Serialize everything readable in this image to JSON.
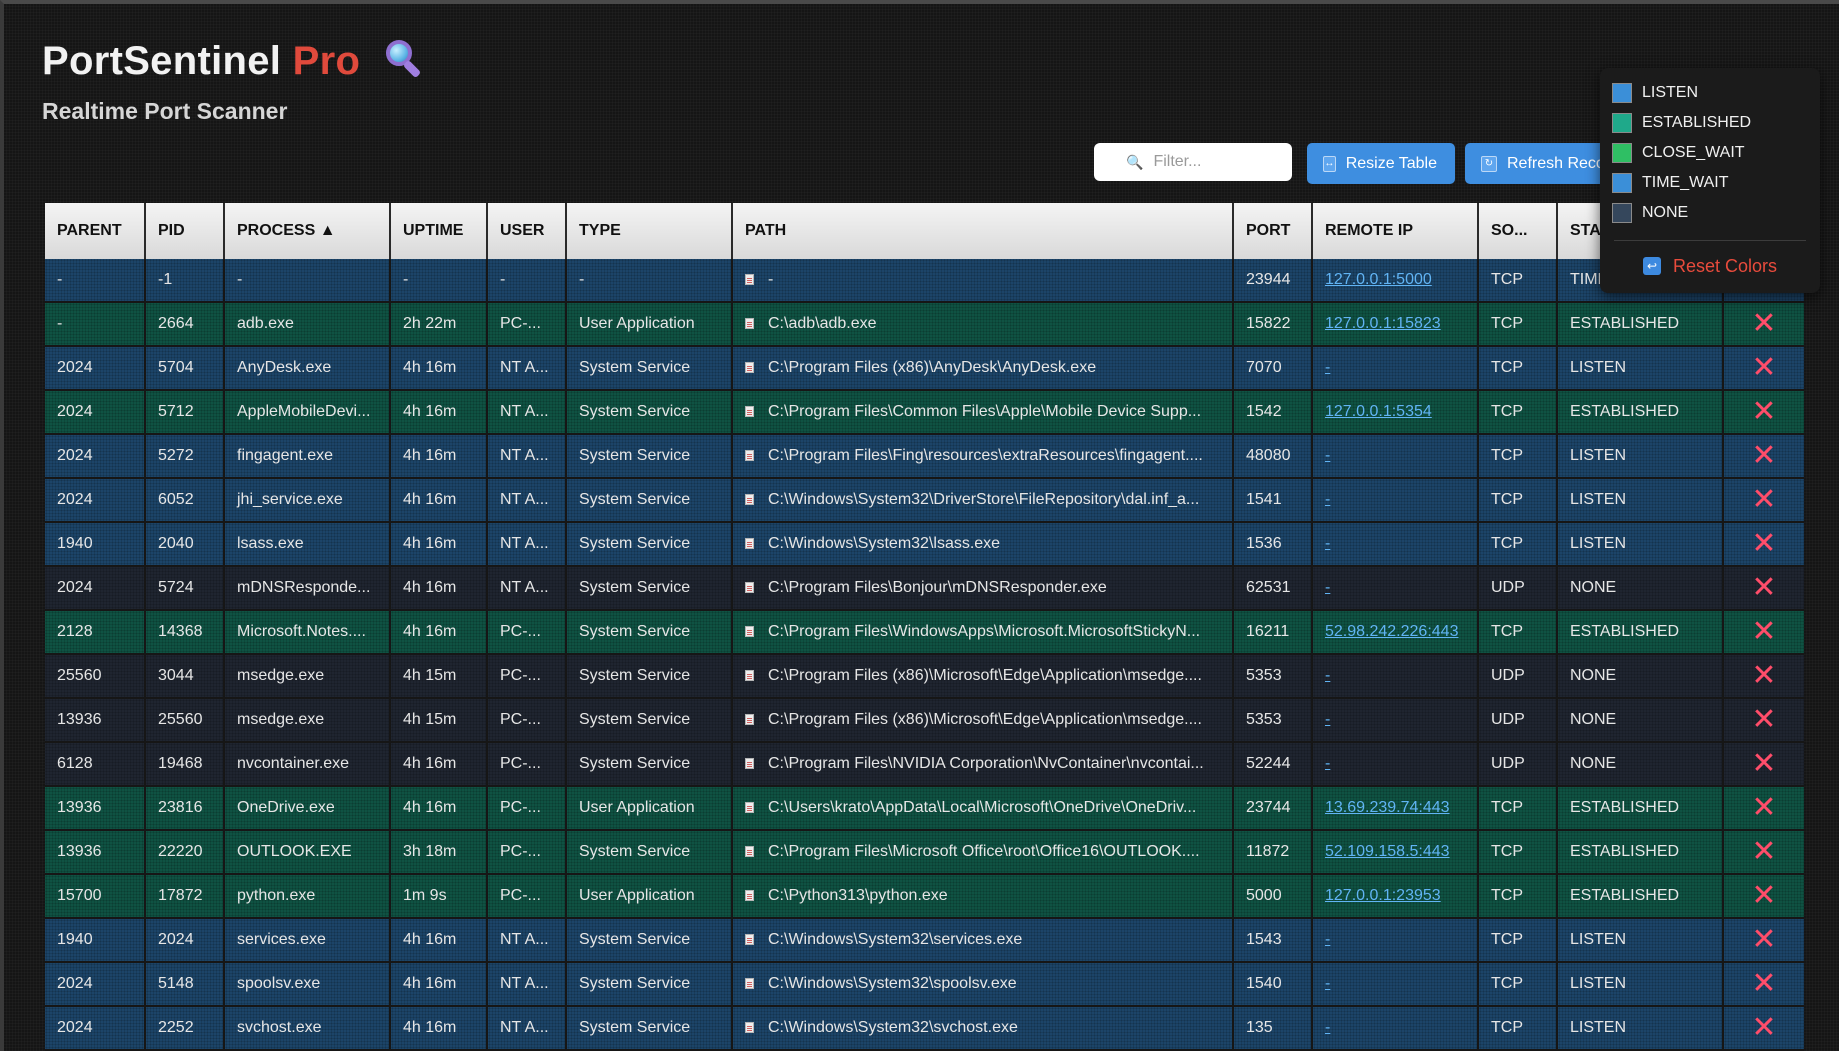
{
  "header": {
    "title_main": "PortSentinel",
    "title_accent": "Pro",
    "subtitle": "Realtime Port Scanner"
  },
  "toolbar": {
    "filter_placeholder": "Filter...",
    "resize_label": "Resize Table",
    "refresh_label": "Refresh Reco"
  },
  "table": {
    "columns": [
      "PARENT",
      "PID",
      "PROCESS ▲",
      "UPTIME",
      "USER",
      "TYPE",
      "PATH",
      "PORT",
      "REMOTE IP",
      "SO...",
      "STA"
    ],
    "rows": [
      {
        "parent": "-",
        "pid": "-1",
        "process": "-",
        "uptime": "-",
        "user": "-",
        "type": "-",
        "path": "-",
        "port": "23944",
        "remote_ip": "127.0.0.1:5000",
        "proto": "TCP",
        "state": "TIME_WAIT"
      },
      {
        "parent": "-",
        "pid": "2664",
        "process": "adb.exe",
        "uptime": "2h 22m",
        "user": "PC-...",
        "type": "User Application",
        "path": "C:\\adb\\adb.exe",
        "port": "15822",
        "remote_ip": "127.0.0.1:15823",
        "proto": "TCP",
        "state": "ESTABLISHED"
      },
      {
        "parent": "2024",
        "pid": "5704",
        "process": "AnyDesk.exe",
        "uptime": "4h 16m",
        "user": "NT A...",
        "type": "System Service",
        "path": "C:\\Program Files (x86)\\AnyDesk\\AnyDesk.exe",
        "port": "7070",
        "remote_ip": "-",
        "proto": "TCP",
        "state": "LISTEN"
      },
      {
        "parent": "2024",
        "pid": "5712",
        "process": "AppleMobileDevi...",
        "uptime": "4h 16m",
        "user": "NT A...",
        "type": "System Service",
        "path": "C:\\Program Files\\Common Files\\Apple\\Mobile Device Supp...",
        "port": "1542",
        "remote_ip": "127.0.0.1:5354",
        "proto": "TCP",
        "state": "ESTABLISHED"
      },
      {
        "parent": "2024",
        "pid": "5272",
        "process": "fingagent.exe",
        "uptime": "4h 16m",
        "user": "NT A...",
        "type": "System Service",
        "path": "C:\\Program Files\\Fing\\resources\\extraResources\\fingagent....",
        "port": "48080",
        "remote_ip": "-",
        "proto": "TCP",
        "state": "LISTEN"
      },
      {
        "parent": "2024",
        "pid": "6052",
        "process": "jhi_service.exe",
        "uptime": "4h 16m",
        "user": "NT A...",
        "type": "System Service",
        "path": "C:\\Windows\\System32\\DriverStore\\FileRepository\\dal.inf_a...",
        "port": "1541",
        "remote_ip": "-",
        "proto": "TCP",
        "state": "LISTEN"
      },
      {
        "parent": "1940",
        "pid": "2040",
        "process": "lsass.exe",
        "uptime": "4h 16m",
        "user": "NT A...",
        "type": "System Service",
        "path": "C:\\Windows\\System32\\lsass.exe",
        "port": "1536",
        "remote_ip": "-",
        "proto": "TCP",
        "state": "LISTEN"
      },
      {
        "parent": "2024",
        "pid": "5724",
        "process": "mDNSResponde...",
        "uptime": "4h 16m",
        "user": "NT A...",
        "type": "System Service",
        "path": "C:\\Program Files\\Bonjour\\mDNSResponder.exe",
        "port": "62531",
        "remote_ip": "-",
        "proto": "UDP",
        "state": "NONE"
      },
      {
        "parent": "2128",
        "pid": "14368",
        "process": "Microsoft.Notes....",
        "uptime": "4h 16m",
        "user": "PC-...",
        "type": "System Service",
        "path": "C:\\Program Files\\WindowsApps\\Microsoft.MicrosoftStickyN...",
        "port": "16211",
        "remote_ip": "52.98.242.226:443",
        "proto": "TCP",
        "state": "ESTABLISHED"
      },
      {
        "parent": "25560",
        "pid": "3044",
        "process": "msedge.exe",
        "uptime": "4h 15m",
        "user": "PC-...",
        "type": "System Service",
        "path": "C:\\Program Files (x86)\\Microsoft\\Edge\\Application\\msedge....",
        "port": "5353",
        "remote_ip": "-",
        "proto": "UDP",
        "state": "NONE"
      },
      {
        "parent": "13936",
        "pid": "25560",
        "process": "msedge.exe",
        "uptime": "4h 15m",
        "user": "PC-...",
        "type": "System Service",
        "path": "C:\\Program Files (x86)\\Microsoft\\Edge\\Application\\msedge....",
        "port": "5353",
        "remote_ip": "-",
        "proto": "UDP",
        "state": "NONE"
      },
      {
        "parent": "6128",
        "pid": "19468",
        "process": "nvcontainer.exe",
        "uptime": "4h 16m",
        "user": "PC-...",
        "type": "System Service",
        "path": "C:\\Program Files\\NVIDIA Corporation\\NvContainer\\nvcontai...",
        "port": "52244",
        "remote_ip": "-",
        "proto": "UDP",
        "state": "NONE"
      },
      {
        "parent": "13936",
        "pid": "23816",
        "process": "OneDrive.exe",
        "uptime": "4h 16m",
        "user": "PC-...",
        "type": "User Application",
        "path": "C:\\Users\\krato\\AppData\\Local\\Microsoft\\OneDrive\\OneDriv...",
        "port": "23744",
        "remote_ip": "13.69.239.74:443",
        "proto": "TCP",
        "state": "ESTABLISHED"
      },
      {
        "parent": "13936",
        "pid": "22220",
        "process": "OUTLOOK.EXE",
        "uptime": "3h 18m",
        "user": "PC-...",
        "type": "System Service",
        "path": "C:\\Program Files\\Microsoft Office\\root\\Office16\\OUTLOOK....",
        "port": "11872",
        "remote_ip": "52.109.158.5:443",
        "proto": "TCP",
        "state": "ESTABLISHED"
      },
      {
        "parent": "15700",
        "pid": "17872",
        "process": "python.exe",
        "uptime": "1m 9s",
        "user": "PC-...",
        "type": "User Application",
        "path": "C:\\Python313\\python.exe",
        "port": "5000",
        "remote_ip": "127.0.0.1:23953",
        "proto": "TCP",
        "state": "ESTABLISHED"
      },
      {
        "parent": "1940",
        "pid": "2024",
        "process": "services.exe",
        "uptime": "4h 16m",
        "user": "NT A...",
        "type": "System Service",
        "path": "C:\\Windows\\System32\\services.exe",
        "port": "1543",
        "remote_ip": "-",
        "proto": "TCP",
        "state": "LISTEN"
      },
      {
        "parent": "2024",
        "pid": "5148",
        "process": "spoolsv.exe",
        "uptime": "4h 16m",
        "user": "NT A...",
        "type": "System Service",
        "path": "C:\\Windows\\System32\\spoolsv.exe",
        "port": "1540",
        "remote_ip": "-",
        "proto": "TCP",
        "state": "LISTEN"
      },
      {
        "parent": "2024",
        "pid": "2252",
        "process": "svchost.exe",
        "uptime": "4h 16m",
        "user": "NT A...",
        "type": "System Service",
        "path": "C:\\Windows\\System32\\svchost.exe",
        "port": "135",
        "remote_ip": "-",
        "proto": "TCP",
        "state": "LISTEN"
      }
    ],
    "kill_glyph": "✕"
  },
  "legend": {
    "items": [
      {
        "label": "LISTEN",
        "color": "#3b8fd8"
      },
      {
        "label": "ESTABLISHED",
        "color": "#1fa98a"
      },
      {
        "label": "CLOSE_WAIT",
        "color": "#2fbf64"
      },
      {
        "label": "TIME_WAIT",
        "color": "#3b8fd8"
      },
      {
        "label": "NONE",
        "color": "#35475c"
      }
    ],
    "reset_label": "Reset Colors"
  }
}
